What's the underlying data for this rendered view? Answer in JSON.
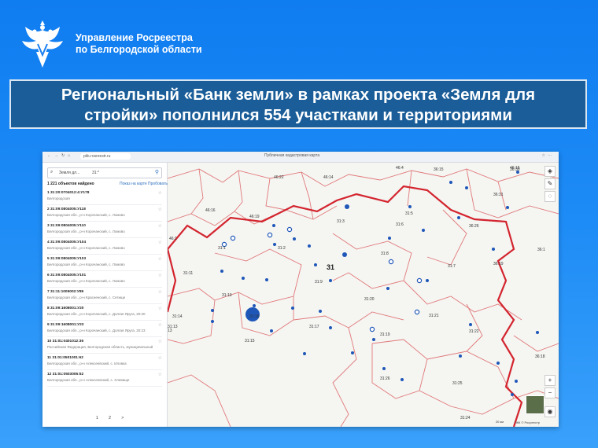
{
  "header": {
    "org_line1": "Управление Росреестра",
    "org_line2": "по Белгородской области"
  },
  "banner": {
    "line1": "Региональный «Банк земли» в рамках проекта «Земля для",
    "line2": "стройки» пополнился 554 участками и территориями"
  },
  "browser": {
    "url": "pkk.rosreestr.ru",
    "title": "Публичная кадастровая карта"
  },
  "panel": {
    "search_left": "Земля дл...",
    "search_right": "31:*",
    "found": "1 221 объектов найдено",
    "link_show": "Показ на карте",
    "link_print": "Пробовать",
    "items": [
      {
        "id": "1  31:20:0704012:4:У178",
        "addr": "Белгородская"
      },
      {
        "id": "2  31:09:0804005:У118",
        "addr": "Белгородская обл., р-н Корочанский, с. Ломово"
      },
      {
        "id": "3  31:09:0804005:У110",
        "addr": "Белгородская обл., р-н Корочанский, с. Ломово"
      },
      {
        "id": "4  31:09:0804005:У104",
        "addr": "Белгородская обл., р-н Корочанский, с. Ломово"
      },
      {
        "id": "5  31:09:0804005:У103",
        "addr": "Белгородская обл., р-н Корочанский, с. Ломово"
      },
      {
        "id": "6  31:09:0804005:У101",
        "addr": "Белгородская обл., р-н Корочанский, с. Ломово"
      },
      {
        "id": "7  31:11:1005002:У89",
        "addr": "Белгородская обл., р-н Красненский, с. Сетище"
      },
      {
        "id": "8  31:09:1608001:У20",
        "addr": "Белгородская обл., р-н Корочанский, с. Долгая Яруга, 20:20"
      },
      {
        "id": "9  31:09:1608001:У23",
        "addr": "Белгородская обл., р-н Корочанский, с. Долгая Яруга, 20:23"
      },
      {
        "id": "10  31:01:0401012:36",
        "addr": "Российская Федерация, Белгородская область, муниципальный район"
      },
      {
        "id": "11  31:01:0501001:62",
        "addr": "Белгородская обл., р-н Алексеевский, с. Иловка"
      },
      {
        "id": "12  31:01:0503005:52",
        "addr": "Белгородская обл., р-н Алексеевский, с. Хлевище"
      }
    ],
    "pages": "1 2 >"
  },
  "map": {
    "region_label": "31",
    "districts": [
      {
        "label": "46:15"
      },
      {
        "label": "46:4"
      },
      {
        "label": "46:22"
      },
      {
        "label": "46:14"
      },
      {
        "label": "46:16"
      },
      {
        "label": "46:19"
      },
      {
        "label": "46:1"
      },
      {
        "label": "36:31"
      },
      {
        "label": "36:26"
      },
      {
        "label": "36:19"
      },
      {
        "label": "36:1"
      },
      {
        "label": "31:3"
      },
      {
        "label": "31:5"
      },
      {
        "label": "31:6"
      },
      {
        "label": "31:1"
      },
      {
        "label": "31:2"
      },
      {
        "label": "31:8"
      },
      {
        "label": "31:9"
      },
      {
        "label": "31:7"
      },
      {
        "label": "31:11"
      },
      {
        "label": "31:10"
      },
      {
        "label": "31:14"
      },
      {
        "label": "31:16"
      },
      {
        "label": "31:13"
      },
      {
        "label": "31:15"
      },
      {
        "label": "31:17"
      },
      {
        "label": "31:19"
      },
      {
        "label": "31:21"
      },
      {
        "label": "31:22"
      },
      {
        "label": "31:20"
      },
      {
        "label": "31:26"
      },
      {
        "label": "31:25"
      },
      {
        "label": "31:24"
      },
      {
        "label": "36:18"
      },
      {
        "label": "36:15"
      },
      {
        "label": "36:30"
      },
      {
        "label": "13"
      }
    ],
    "scale": "20 км",
    "copyright": "ПКК © Росреестр"
  },
  "colors": {
    "background": "#1e8cf6",
    "banner": "#1a5d98",
    "border_region": "#d3242e",
    "border_district": "#e07a7a",
    "point": "#1f57b8"
  }
}
